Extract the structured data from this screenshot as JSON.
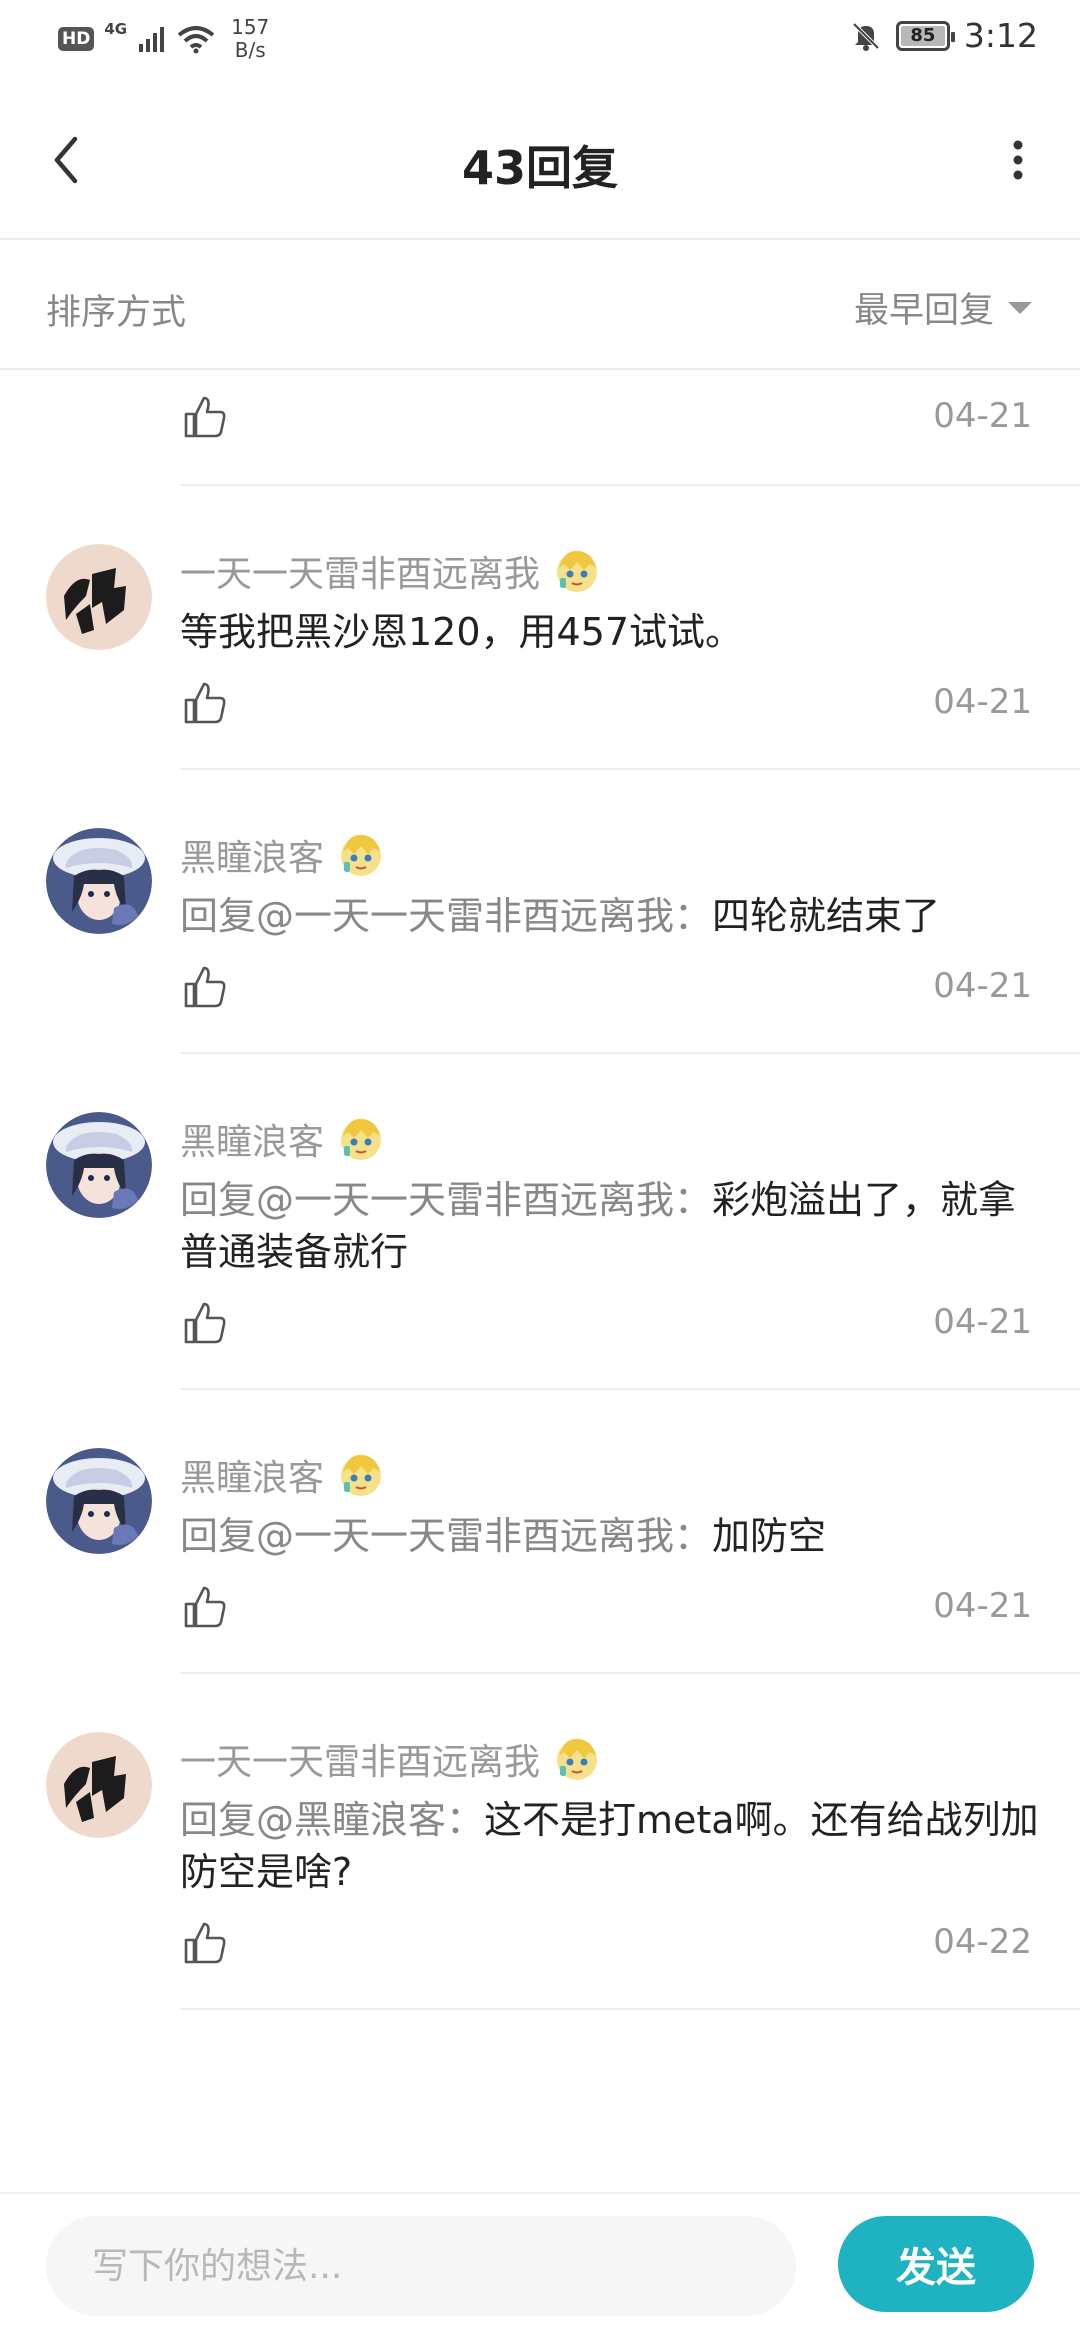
{
  "status_bar": {
    "hd": "HD",
    "network": "4G",
    "speed_value": "157",
    "speed_unit": "B/s",
    "battery": "85",
    "time": "3:12"
  },
  "header": {
    "title": "43回复",
    "back_icon": "chevron-left-icon",
    "more_icon": "more-vertical-icon"
  },
  "sort": {
    "label": "排序方式",
    "value": "最早回复"
  },
  "replies": [
    {
      "user": "",
      "text": "",
      "date": "04-21"
    },
    {
      "user": "一天一天雷非酉远离我",
      "text": "等我把黑沙恩120，用457试试。",
      "date": "04-21"
    },
    {
      "user": "黑瞳浪客",
      "mention": "回复@一天一天雷非酉远离我：",
      "text": "四轮就结束了",
      "date": "04-21"
    },
    {
      "user": "黑瞳浪客",
      "mention": "回复@一天一天雷非酉远离我：",
      "text": "彩炮溢出了，就拿普通装备就行",
      "date": "04-21"
    },
    {
      "user": "黑瞳浪客",
      "mention": "回复@一天一天雷非酉远离我：",
      "text": "加防空",
      "date": "04-21"
    },
    {
      "user": "一天一天雷非酉远离我",
      "mention": "回复@黑瞳浪客：",
      "text": "这不是打meta啊。还有给战列加防空是啥?",
      "date": "04-22"
    }
  ],
  "input": {
    "placeholder": "写下你的想法...",
    "send_label": "发送"
  },
  "colors": {
    "accent": "#1fb3c2",
    "muted_text": "#999999",
    "divider": "#eeeeee"
  }
}
